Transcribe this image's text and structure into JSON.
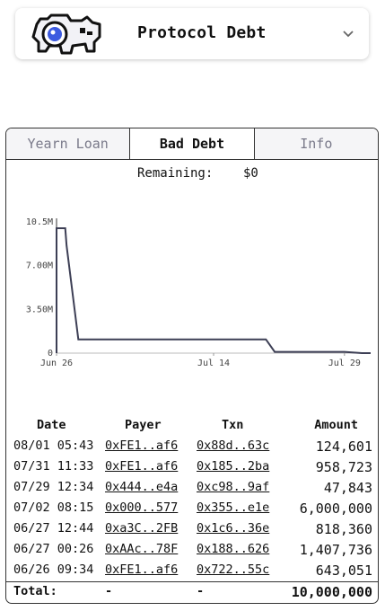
{
  "header": {
    "title": "Protocol Debt",
    "logo_icon": "cartoon-creature-logo",
    "dropdown_icon": "chevron-down-icon"
  },
  "tabs": [
    {
      "label": "Yearn Loan",
      "active": false
    },
    {
      "label": "Bad Debt",
      "active": true
    },
    {
      "label": "Info",
      "active": false
    }
  ],
  "remaining": {
    "label": "Remaining:",
    "value": "$0"
  },
  "chart_data": {
    "type": "line",
    "title": "",
    "xlabel": "",
    "ylabel": "",
    "yticks": [
      "0",
      "3.50M",
      "7.00M",
      "10.5M"
    ],
    "xticks": [
      "Jun 26",
      "Jul 14",
      "Jul 29"
    ],
    "ylim": [
      0,
      10500000
    ],
    "series": [
      {
        "points": [
          [
            "06/26",
            0
          ],
          [
            "06/26",
            10000000
          ],
          [
            "06/27",
            10000000
          ],
          [
            "06/27",
            8600000
          ],
          [
            "06/27",
            7800000
          ],
          [
            "06/28",
            1100000
          ],
          [
            "07/02",
            1100000
          ],
          [
            "07/20",
            1100000
          ],
          [
            "07/21",
            100000
          ],
          [
            "07/29",
            100000
          ],
          [
            "07/31",
            0
          ],
          [
            "08/01",
            0
          ]
        ]
      }
    ],
    "colors": {
      "line": "#3d3f55",
      "axis": "#333333"
    }
  },
  "table": {
    "headers": {
      "date": "Date",
      "payer": "Payer",
      "txn": "Txn",
      "amount": "Amount"
    },
    "rows": [
      {
        "date": "08/01 05:43",
        "payer": "0xFE1..af6",
        "txn": "0x88d..63c",
        "amount": "124,601"
      },
      {
        "date": "07/31 11:33",
        "payer": "0xFE1..af6",
        "txn": "0x185..2ba",
        "amount": "958,723"
      },
      {
        "date": "07/29 12:34",
        "payer": "0x444..e4a",
        "txn": "0xc98..9af",
        "amount": "47,843"
      },
      {
        "date": "07/02 08:15",
        "payer": "0x000..577",
        "txn": "0x355..e1e",
        "amount": "6,000,000"
      },
      {
        "date": "06/27 12:44",
        "payer": "0xa3C..2FB",
        "txn": "0x1c6..36e",
        "amount": "818,360"
      },
      {
        "date": "06/27 00:26",
        "payer": "0xAAc..78F",
        "txn": "0x188..626",
        "amount": "1,407,736"
      },
      {
        "date": "06/26 09:34",
        "payer": "0xFE1..af6",
        "txn": "0x722..55c",
        "amount": "643,051"
      }
    ],
    "total": {
      "label": "Total:",
      "payer": "-",
      "txn": "-",
      "amount": "10,000,000"
    }
  }
}
